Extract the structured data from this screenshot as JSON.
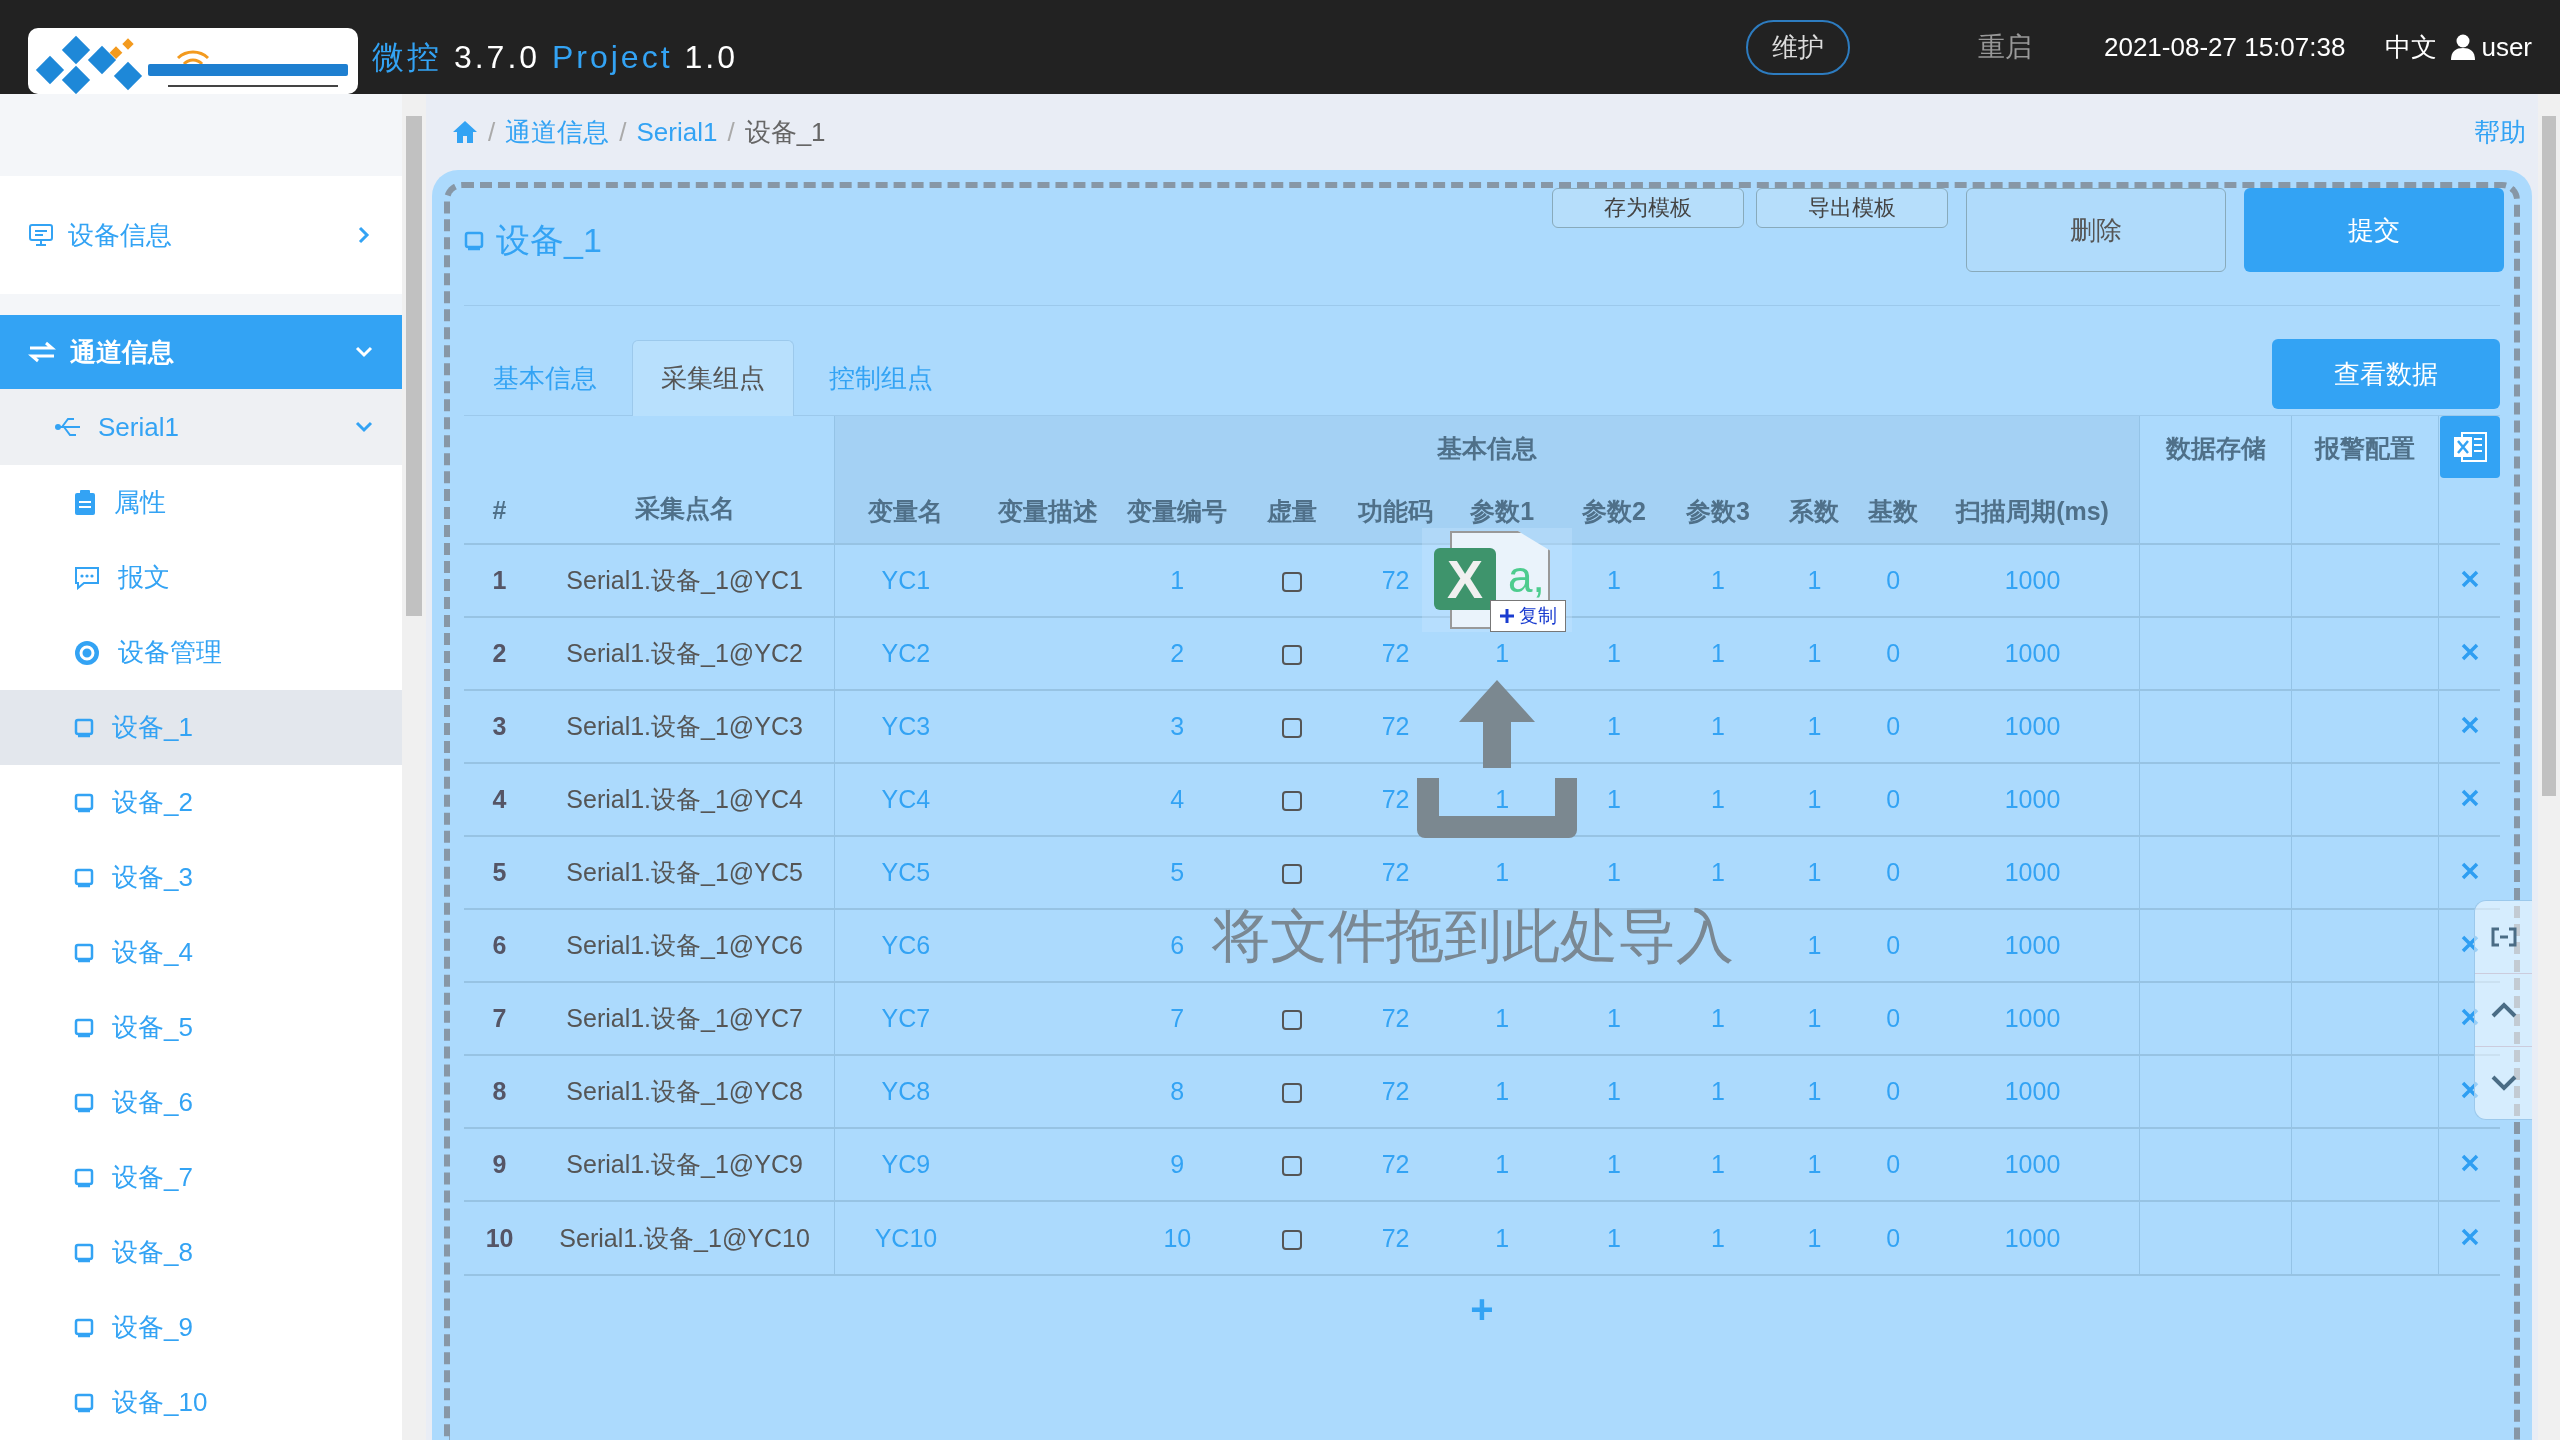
{
  "top_bar": {
    "app_name": "微控",
    "version": "3.7.0",
    "project_label": "Project",
    "project_version": "1.0",
    "maintain_button": "维护",
    "restart_button": "重启",
    "datetime": "2021-08-27 15:07:38",
    "language": "中文",
    "user": "user"
  },
  "sidebar": {
    "sections": [
      {
        "label": "设备信息",
        "kind": "info",
        "selected": false,
        "expanded": false
      },
      {
        "label": "通道信息",
        "kind": "channel",
        "selected": true,
        "expanded": true,
        "children": [
          {
            "label": "Serial1",
            "expanded": true,
            "children": [
              {
                "label": "属性",
                "kind": "clipboard",
                "selected": false
              },
              {
                "label": "报文",
                "kind": "message",
                "selected": false
              },
              {
                "label": "设备管理",
                "kind": "gear",
                "selected": false
              },
              {
                "label": "设备_1",
                "kind": "device",
                "selected": true
              },
              {
                "label": "设备_2",
                "kind": "device",
                "selected": false
              },
              {
                "label": "设备_3",
                "kind": "device",
                "selected": false
              },
              {
                "label": "设备_4",
                "kind": "device",
                "selected": false
              },
              {
                "label": "设备_5",
                "kind": "device",
                "selected": false
              },
              {
                "label": "设备_6",
                "kind": "device",
                "selected": false
              },
              {
                "label": "设备_7",
                "kind": "device",
                "selected": false
              },
              {
                "label": "设备_8",
                "kind": "device",
                "selected": false
              },
              {
                "label": "设备_9",
                "kind": "device",
                "selected": false
              },
              {
                "label": "设备_10",
                "kind": "device",
                "selected": false
              }
            ]
          }
        ]
      }
    ]
  },
  "breadcrumb": [
    "通道信息",
    "Serial1",
    "设备_1"
  ],
  "breadcrumb_separator": "/",
  "help_link": "帮助",
  "card": {
    "title": "设备_1",
    "buttons": [
      {
        "label": "存为模板",
        "kind": "small"
      },
      {
        "label": "导出模板",
        "kind": "small"
      },
      {
        "label": "删除",
        "kind": "default"
      },
      {
        "label": "提交",
        "kind": "primary"
      }
    ]
  },
  "tabs": [
    {
      "label": "基本信息",
      "selected": false
    },
    {
      "label": "采集组点",
      "selected": true
    },
    {
      "label": "控制组点",
      "selected": false
    }
  ],
  "view_data_button": "查看数据",
  "table": {
    "group_headers": [
      "基本信息",
      "数据存储",
      "报警配置"
    ],
    "columns": [
      "#",
      "采集点名",
      "变量名",
      "变量描述",
      "变量编号",
      "虚量",
      "功能码",
      "参数1",
      "参数2",
      "参数3",
      "系数",
      "基数",
      "扫描周期(ms)"
    ],
    "rows": [
      {
        "index": "1",
        "point_name": "Serial1.设备_1@YC1",
        "var_name": "YC1",
        "var_no": "1",
        "virtual": false,
        "func_code": "72",
        "param2": "1",
        "param3": "1",
        "coef": "1",
        "base": "0",
        "period": "1000"
      },
      {
        "index": "2",
        "point_name": "Serial1.设备_1@YC2",
        "var_name": "YC2",
        "var_no": "2",
        "virtual": false,
        "func_code": "72",
        "param1": "1",
        "param2": "1",
        "param3": "1",
        "coef": "1",
        "base": "0",
        "period": "1000"
      },
      {
        "index": "3",
        "point_name": "Serial1.设备_1@YC3",
        "var_name": "YC3",
        "var_no": "3",
        "virtual": false,
        "func_code": "72",
        "param2": "1",
        "param3": "1",
        "coef": "1",
        "base": "0",
        "period": "1000"
      },
      {
        "index": "4",
        "point_name": "Serial1.设备_1@YC4",
        "var_name": "YC4",
        "var_no": "4",
        "virtual": false,
        "func_code": "72",
        "param1": "1",
        "param2": "1",
        "param3": "1",
        "coef": "1",
        "base": "0",
        "period": "1000"
      },
      {
        "index": "5",
        "point_name": "Serial1.设备_1@YC5",
        "var_name": "YC5",
        "var_no": "5",
        "virtual": false,
        "func_code": "72",
        "param1": "1",
        "param2": "1",
        "param3": "1",
        "coef": "1",
        "base": "0",
        "period": "1000"
      },
      {
        "index": "6",
        "point_name": "Serial1.设备_1@YC6",
        "var_name": "YC6",
        "var_no": "6",
        "coef": "1",
        "base": "0",
        "period": "1000"
      },
      {
        "index": "7",
        "point_name": "Serial1.设备_1@YC7",
        "var_name": "YC7",
        "var_no": "7",
        "virtual": false,
        "func_code": "72",
        "param1": "1",
        "param2": "1",
        "param3": "1",
        "coef": "1",
        "base": "0",
        "period": "1000"
      },
      {
        "index": "8",
        "point_name": "Serial1.设备_1@YC8",
        "var_name": "YC8",
        "var_no": "8",
        "virtual": false,
        "func_code": "72",
        "param1": "1",
        "param2": "1",
        "param3": "1",
        "coef": "1",
        "base": "0",
        "period": "1000"
      },
      {
        "index": "9",
        "point_name": "Serial1.设备_1@YC9",
        "var_name": "YC9",
        "var_no": "9",
        "virtual": false,
        "func_code": "72",
        "param1": "1",
        "param2": "1",
        "param3": "1",
        "coef": "1",
        "base": "0",
        "period": "1000"
      },
      {
        "index": "10",
        "point_name": "Serial1.设备_1@YC10",
        "var_name": "YC10",
        "var_no": "10",
        "virtual": false,
        "func_code": "72",
        "param1": "1",
        "param2": "1",
        "param3": "1",
        "coef": "1",
        "base": "0",
        "period": "1000"
      }
    ],
    "add_button": "+"
  },
  "drop_zone": {
    "text": "将文件拖到此处导入"
  },
  "drag_preview": {
    "icon_letter": "X",
    "icon_text": "a,",
    "badge": "复制"
  }
}
